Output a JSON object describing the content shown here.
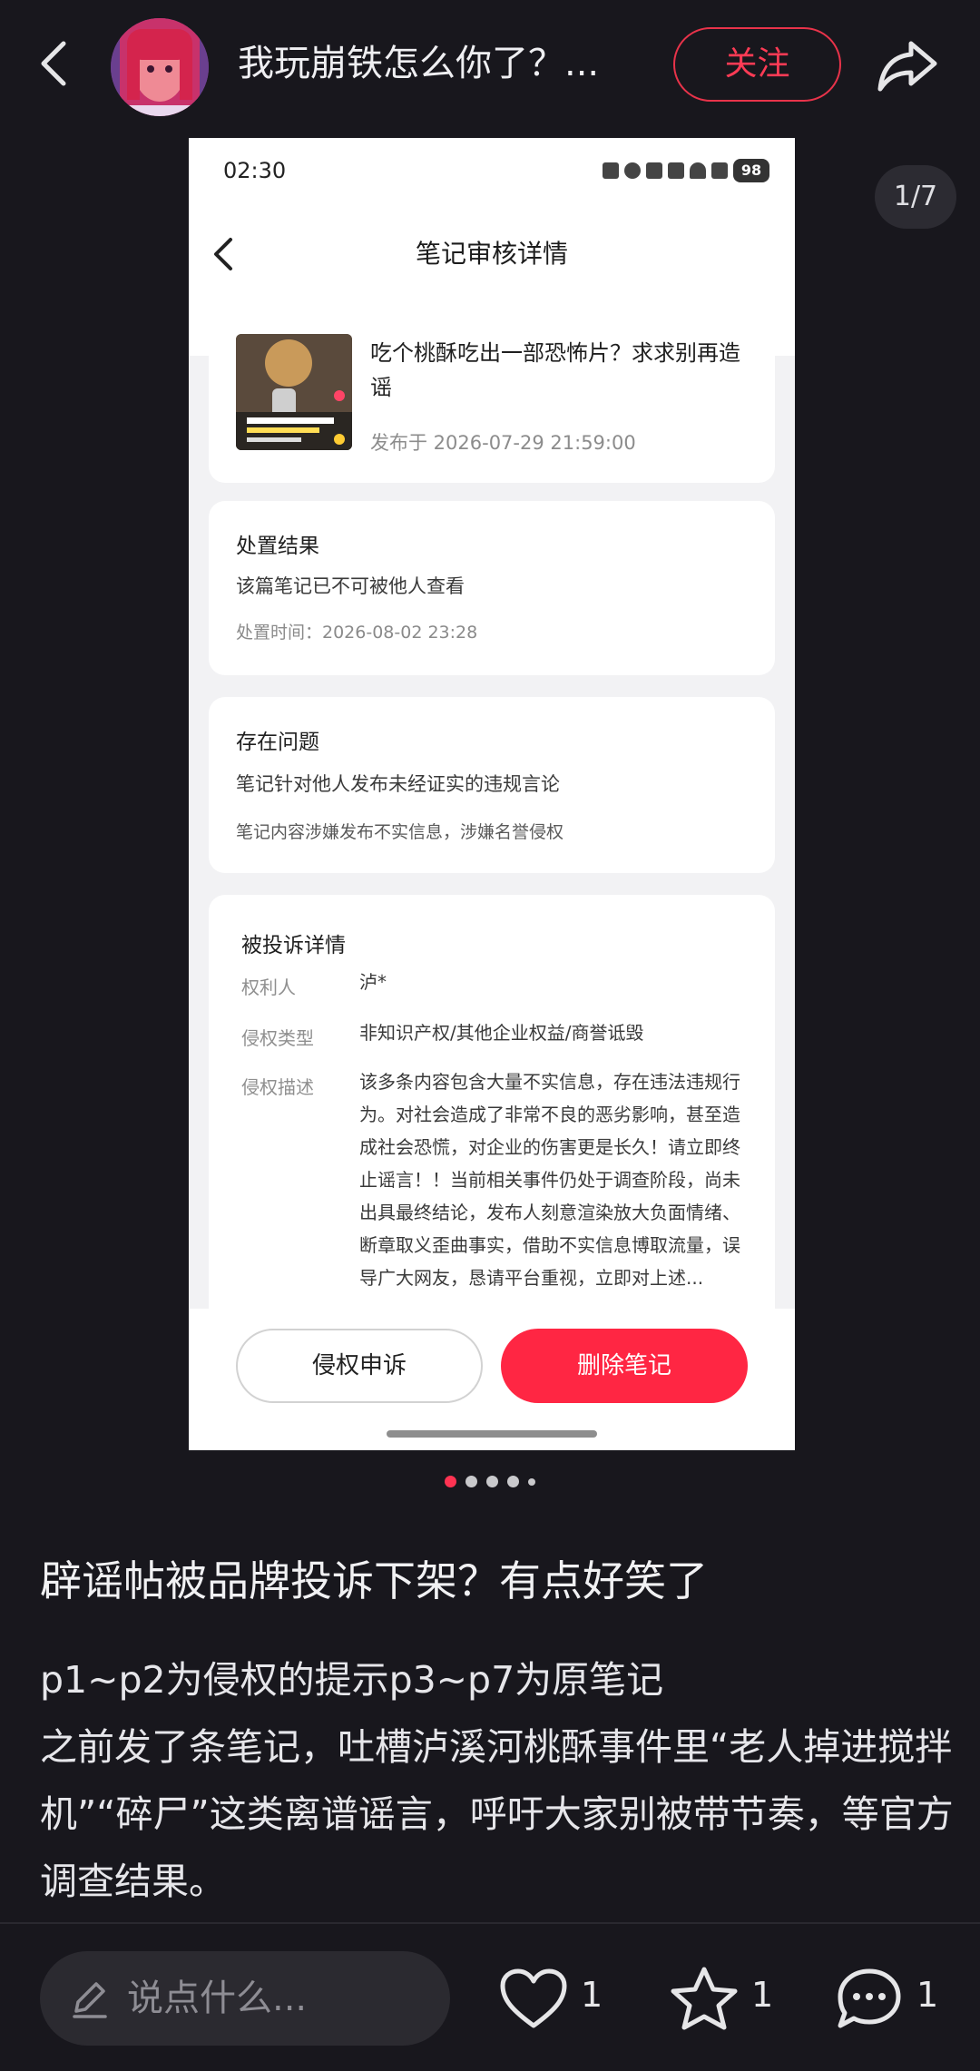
{
  "header": {
    "author": "我玩崩铁怎么你了？...",
    "follow_label": "关注"
  },
  "image_counter": "1/7",
  "screenshot": {
    "time": "02:30",
    "battery": "98",
    "nav_title": "笔记审核详情",
    "note": {
      "title": "吃个桃酥吃出一部恐怖片？求求别再造谣",
      "published": "发布于 2026-07-29 21:59:00"
    },
    "result": {
      "heading": "处置结果",
      "text": "该篇笔记已不可被他人查看",
      "time": "处置时间：2026-08-02 23:28"
    },
    "issues": {
      "heading": "存在问题",
      "item1": "笔记针对他人发布未经证实的违规言论",
      "item2": "笔记内容涉嫌发布不实信息，涉嫌名誉侵权"
    },
    "complaint": {
      "heading": "被投诉详情",
      "owner_label": "权利人",
      "owner_value": "泸*",
      "type_label": "侵权类型",
      "type_value": "非知识产权/其他企业权益/商誉诋毁",
      "desc_label": "侵权描述",
      "desc_value": "该多条内容包含大量不实信息，存在违法违规行为。对社会造成了非常不良的恶劣影响，甚至造成社会恐慌，对企业的伤害更是长久！请立即终止谣言！！当前相关事件仍处于调查阶段，尚未出具最终结论，发布人刻意渲染放大负面情绪、断章取义歪曲事实，借助不实信息博取流量，误导广大网友，恳请平台重视，立即对上述..."
    },
    "appeal_label": "侵权申诉",
    "delete_label": "删除笔记"
  },
  "carousel": {
    "count": 5,
    "active_index": 0
  },
  "post": {
    "title": "辟谣帖被品牌投诉下架？有点好笑了",
    "line1": "p1~p2为侵权的提示p3~p7为原笔记",
    "line2": "之前发了条笔记，吐槽泸溪河桃酥事件里“老人掉进搅拌机”“碎尸”这类离谱谣言，呼吁大家别被带节奏，等官方调查结果。"
  },
  "footer": {
    "comment_placeholder": "说点什么...",
    "likes": "1",
    "favorites": "1",
    "comments": "1"
  },
  "colors": {
    "background": "#18171d",
    "accent": "#ff2643",
    "text": "#e8e8ea"
  },
  "icons": [
    "back-icon",
    "share-icon",
    "edit-icon",
    "heart-icon",
    "star-icon",
    "comment-icon"
  ]
}
